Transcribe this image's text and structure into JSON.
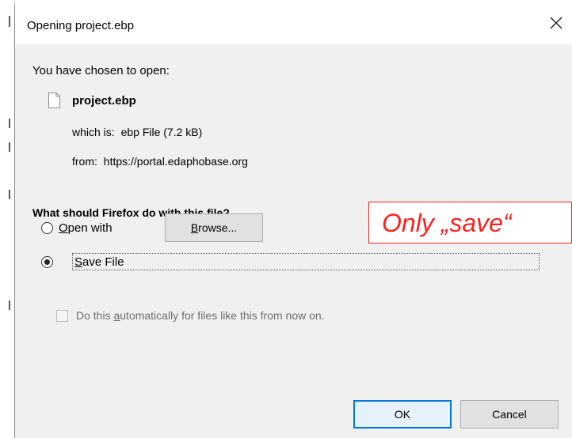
{
  "dialog": {
    "title": "Opening project.ebp",
    "intro": "You have chosen to open:",
    "file_name": "project.ebp",
    "which_is_label": "which is:",
    "which_is_value": "ebp File (7.2 kB)",
    "from_label": "from:",
    "from_value": "https://portal.edaphobase.org",
    "question": "What should Firefox do with this file?",
    "options": {
      "open_with": {
        "pre": "",
        "key": "O",
        "post": "pen with",
        "selected": false
      },
      "save_file": {
        "pre": "",
        "key": "S",
        "post": "ave File",
        "selected": true
      }
    },
    "browse": {
      "pre": "",
      "key": "B",
      "post": "rowse..."
    },
    "auto": {
      "pre": "Do this ",
      "key": "a",
      "post": "utomatically for files like this from now on.",
      "checked": false,
      "enabled": false
    },
    "ok_label": "OK",
    "cancel_label": "Cancel"
  },
  "annotation": {
    "text": "Only „save“",
    "color": "#ff2020"
  },
  "colors": {
    "dialog_bg": "#f0f0f0",
    "titlebar_bg": "#ffffff",
    "default_button_border": "#0078d7"
  },
  "icons": {
    "close": "close-icon",
    "file": "file-icon"
  }
}
